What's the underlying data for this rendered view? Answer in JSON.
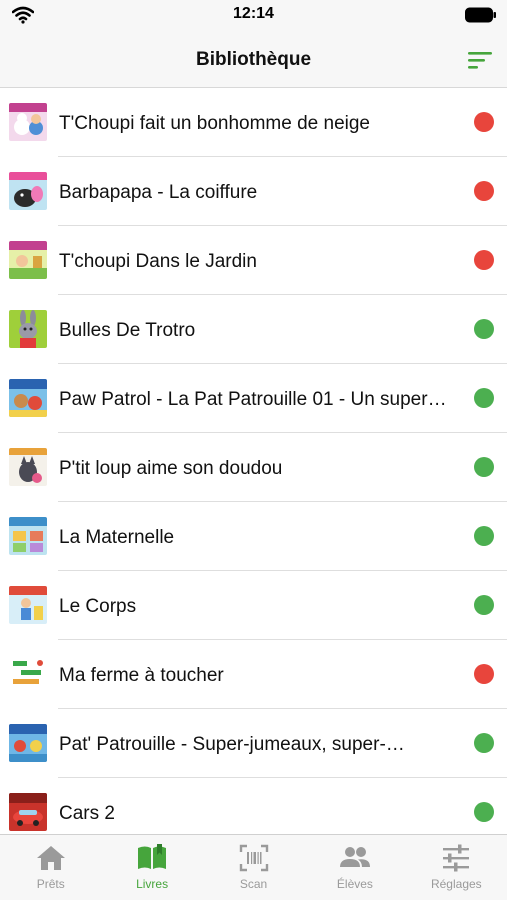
{
  "status_bar": {
    "time": "12:14"
  },
  "header": {
    "title": "Bibliothèque"
  },
  "colors": {
    "accent": "#46a53c",
    "available": "#4caf50",
    "unavailable": "#e8453c"
  },
  "books": [
    {
      "title": "T'Choupi fait un bonhomme de neige",
      "status": "unavailable",
      "cover_icon": "tchoupi-snowman-cover"
    },
    {
      "title": "Barbapapa - La coiffure",
      "status": "unavailable",
      "cover_icon": "barbapapa-cover"
    },
    {
      "title": "T'choupi Dans le Jardin",
      "status": "unavailable",
      "cover_icon": "tchoupi-garden-cover"
    },
    {
      "title": "Bulles De Trotro",
      "status": "available",
      "cover_icon": "trotro-cover"
    },
    {
      "title": "Paw Patrol - La Pat Patrouille 01 - Un super…",
      "status": "available",
      "cover_icon": "paw-patrol-cover"
    },
    {
      "title": "P'tit loup aime son doudou",
      "status": "available",
      "cover_icon": "ptit-loup-cover"
    },
    {
      "title": "La Maternelle",
      "status": "available",
      "cover_icon": "maternelle-cover"
    },
    {
      "title": "Le Corps",
      "status": "available",
      "cover_icon": "corps-cover"
    },
    {
      "title": "Ma ferme à toucher",
      "status": "unavailable",
      "cover_icon": "ferme-cover"
    },
    {
      "title": "Pat' Patrouille - Super-jumeaux, super-…",
      "status": "available",
      "cover_icon": "pat-patrouille-cover"
    },
    {
      "title": "Cars 2",
      "status": "available",
      "cover_icon": "cars-cover"
    }
  ],
  "tabs": [
    {
      "label": "Prêts",
      "icon": "home-icon",
      "active": false
    },
    {
      "label": "Livres",
      "icon": "book-icon",
      "active": true
    },
    {
      "label": "Scan",
      "icon": "scan-icon",
      "active": false
    },
    {
      "label": "Élèves",
      "icon": "people-icon",
      "active": false
    },
    {
      "label": "Réglages",
      "icon": "sliders-icon",
      "active": false
    }
  ]
}
